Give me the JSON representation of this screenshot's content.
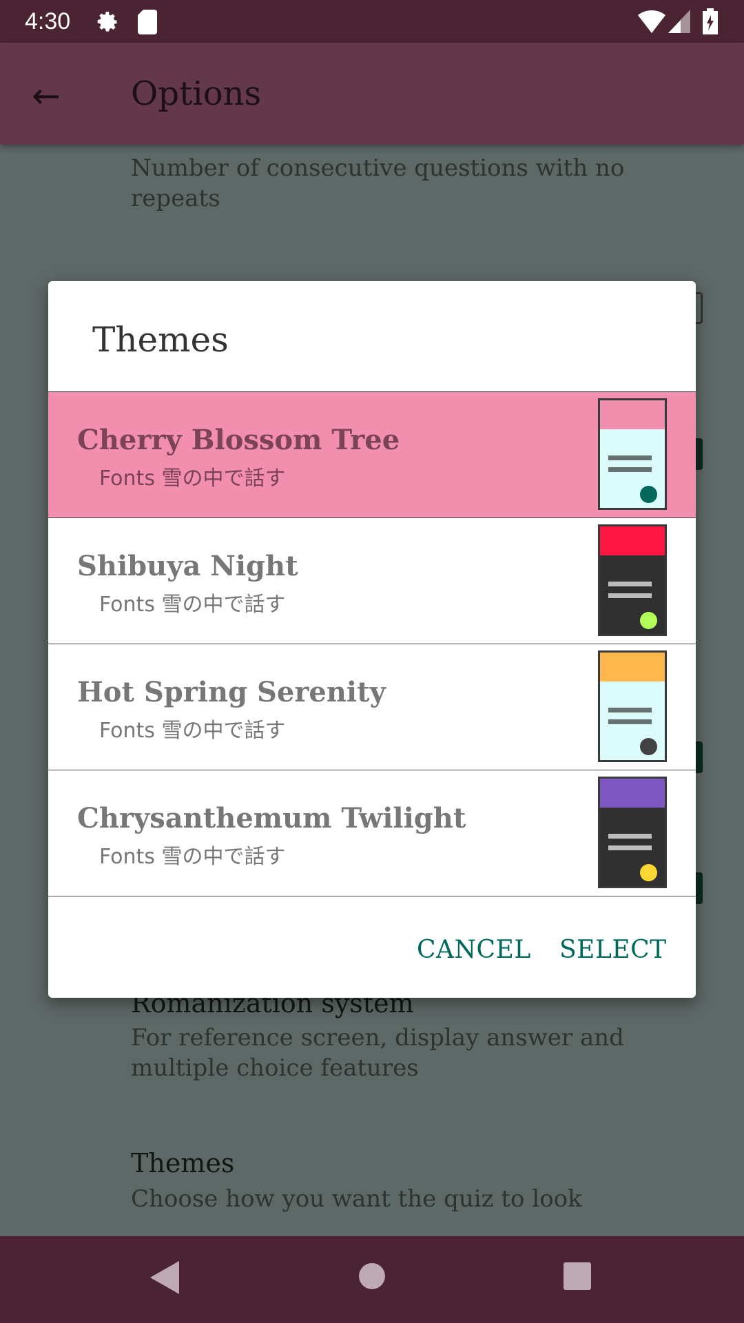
{
  "status_bar": {
    "time": "4:30",
    "icons": [
      "gear-icon",
      "sd-card-icon",
      "wifi-icon",
      "signal-icon",
      "battery-charging-icon"
    ]
  },
  "app_bar": {
    "title": "Options",
    "back_icon": "arrow-left-icon"
  },
  "background": {
    "top_item_subtitle": "Number of consecutive questions with no repeats",
    "romanization": {
      "title": "Romanization system",
      "subtitle": "For reference screen, display answer and multiple choice features"
    },
    "themes": {
      "title": "Themes",
      "subtitle": "Choose how you want the quiz to look"
    }
  },
  "dialog": {
    "title": "Themes",
    "items": [
      {
        "name": "Cherry Blossom Tree",
        "sub": "Fonts 雪の中で話す",
        "selected": true,
        "colors": {
          "header": "#f28faf",
          "body": "#dcfcfc",
          "lines": "#657070",
          "dot": "#00695c"
        }
      },
      {
        "name": "Shibuya Night",
        "sub": "Fonts 雪の中で話す",
        "selected": false,
        "colors": {
          "header": "#ff1744",
          "body": "#303030",
          "lines": "#bdbdbd",
          "dot": "#b2ff59"
        }
      },
      {
        "name": "Hot Spring Serenity",
        "sub": "Fonts 雪の中で話す",
        "selected": false,
        "colors": {
          "header": "#ffb74d",
          "body": "#dcfcfc",
          "lines": "#657070",
          "dot": "#424242"
        }
      },
      {
        "name": "Chrysanthemum Twilight",
        "sub": "Fonts 雪の中で話す",
        "selected": false,
        "colors": {
          "header": "#7e57c2",
          "body": "#303030",
          "lines": "#bdbdbd",
          "dot": "#fdd835"
        }
      }
    ],
    "cancel": "CANCEL",
    "select": "SELECT"
  },
  "nav_bar": {
    "icons": [
      "back-triangle-icon",
      "home-circle-icon",
      "recents-square-icon"
    ]
  }
}
